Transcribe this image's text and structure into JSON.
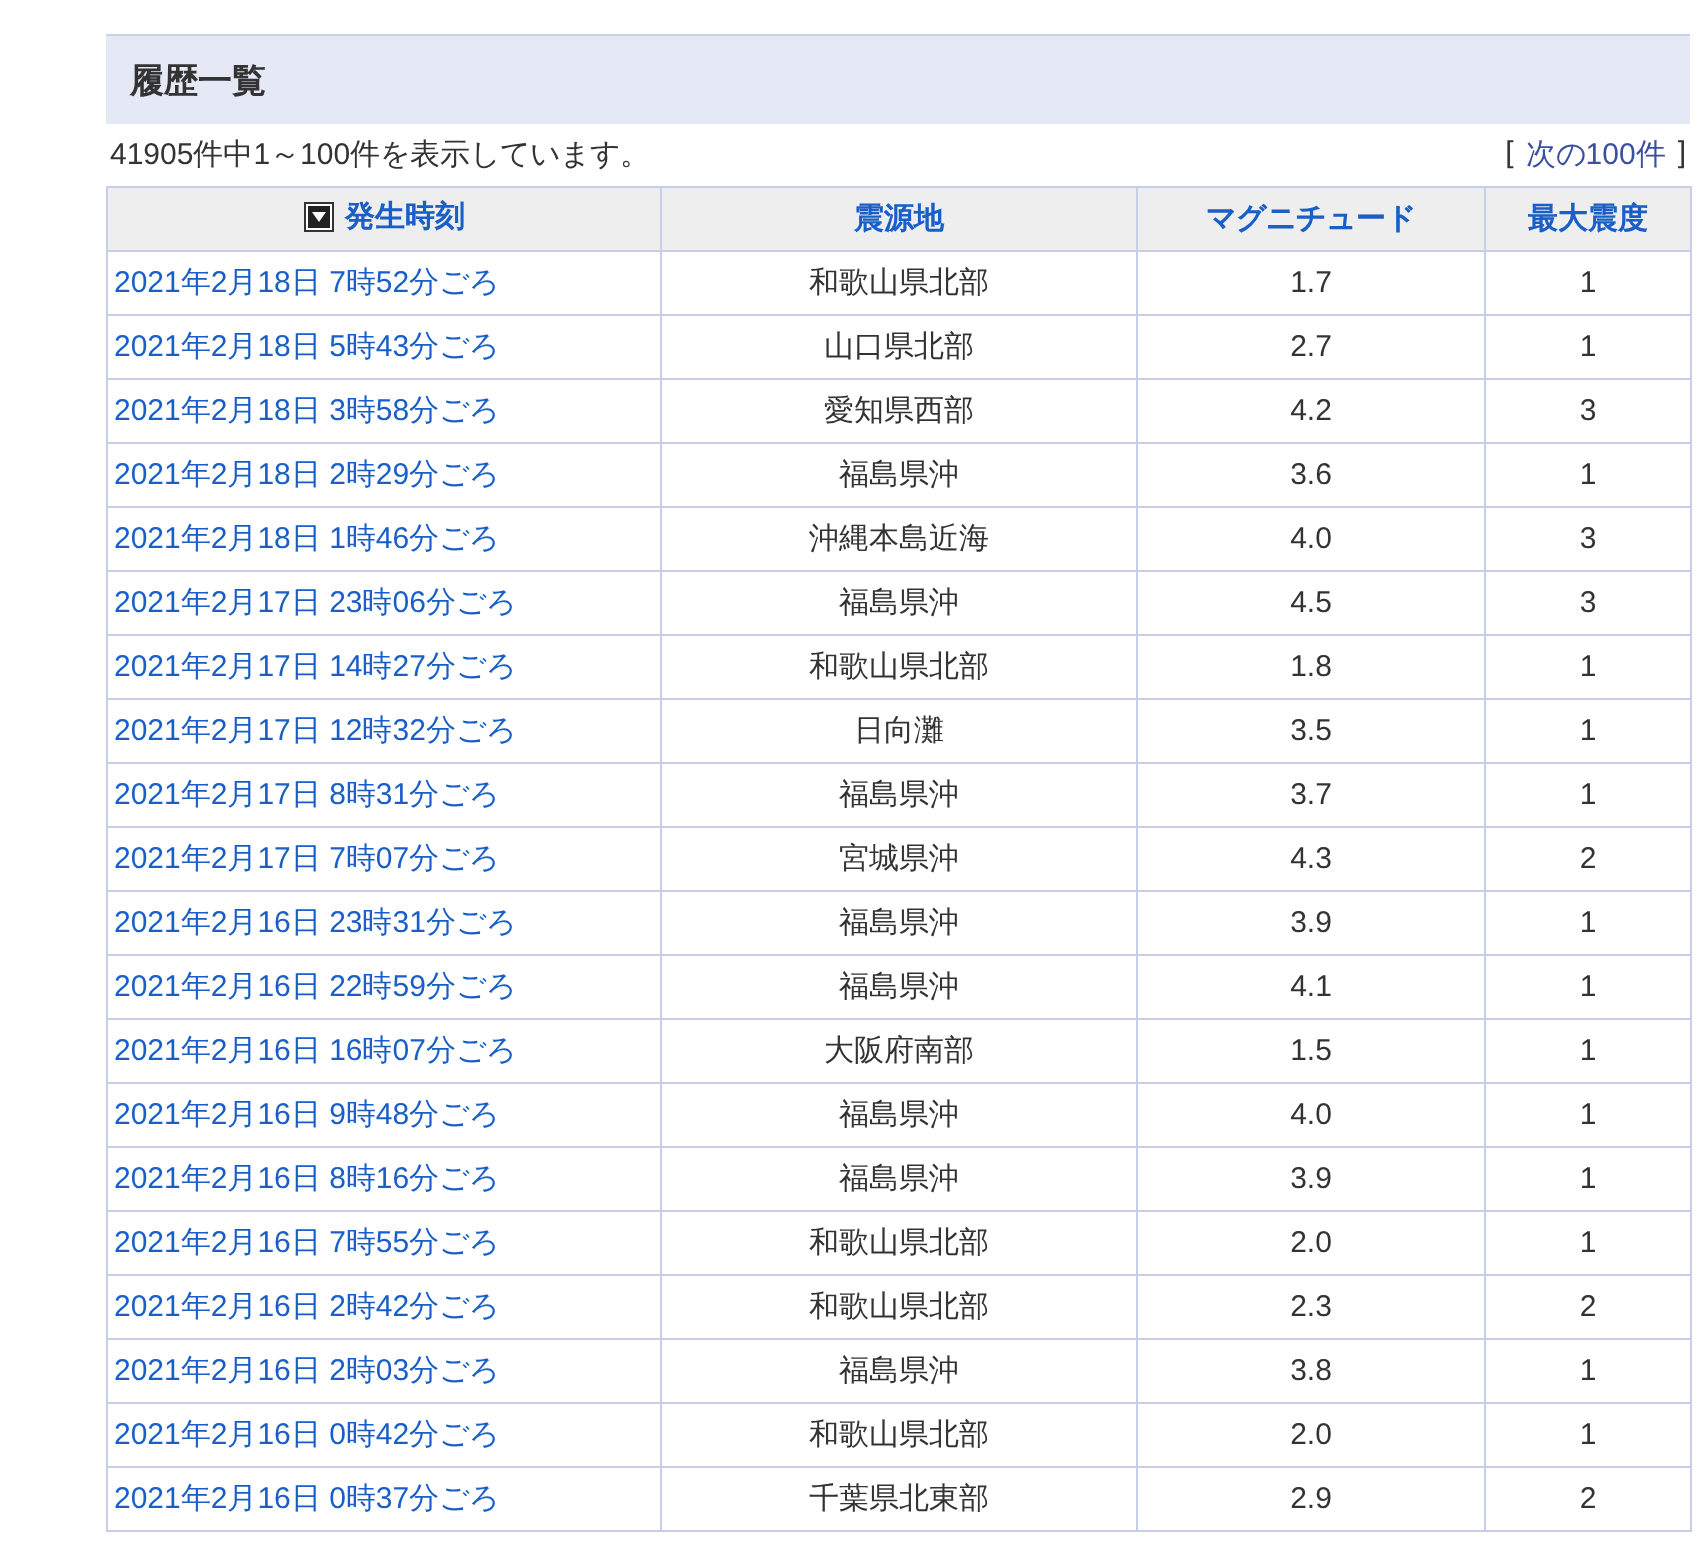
{
  "section": {
    "title": "履歴一覧"
  },
  "summary": "41905件中1～100件を表示しています。",
  "next_link": {
    "open": "[",
    "label": "次の100件",
    "close": "]"
  },
  "table": {
    "columns": [
      {
        "label": "発生時刻",
        "sorted": true
      },
      {
        "label": "震源地",
        "sorted": false
      },
      {
        "label": "マグニチュード",
        "sorted": false
      },
      {
        "label": "最大震度",
        "sorted": false
      }
    ],
    "rows": [
      [
        "2021年2月18日 7時52分ごろ",
        "和歌山県北部",
        "1.7",
        "1"
      ],
      [
        "2021年2月18日 5時43分ごろ",
        "山口県北部",
        "2.7",
        "1"
      ],
      [
        "2021年2月18日 3時58分ごろ",
        "愛知県西部",
        "4.2",
        "3"
      ],
      [
        "2021年2月18日 2時29分ごろ",
        "福島県沖",
        "3.6",
        "1"
      ],
      [
        "2021年2月18日 1時46分ごろ",
        "沖縄本島近海",
        "4.0",
        "3"
      ],
      [
        "2021年2月17日 23時06分ごろ",
        "福島県沖",
        "4.5",
        "3"
      ],
      [
        "2021年2月17日 14時27分ごろ",
        "和歌山県北部",
        "1.8",
        "1"
      ],
      [
        "2021年2月17日 12時32分ごろ",
        "日向灘",
        "3.5",
        "1"
      ],
      [
        "2021年2月17日 8時31分ごろ",
        "福島県沖",
        "3.7",
        "1"
      ],
      [
        "2021年2月17日 7時07分ごろ",
        "宮城県沖",
        "4.3",
        "2"
      ],
      [
        "2021年2月16日 23時31分ごろ",
        "福島県沖",
        "3.9",
        "1"
      ],
      [
        "2021年2月16日 22時59分ごろ",
        "福島県沖",
        "4.1",
        "1"
      ],
      [
        "2021年2月16日 16時07分ごろ",
        "大阪府南部",
        "1.5",
        "1"
      ],
      [
        "2021年2月16日 9時48分ごろ",
        "福島県沖",
        "4.0",
        "1"
      ],
      [
        "2021年2月16日 8時16分ごろ",
        "福島県沖",
        "3.9",
        "1"
      ],
      [
        "2021年2月16日 7時55分ごろ",
        "和歌山県北部",
        "2.0",
        "1"
      ],
      [
        "2021年2月16日 2時42分ごろ",
        "和歌山県北部",
        "2.3",
        "2"
      ],
      [
        "2021年2月16日 2時03分ごろ",
        "福島県沖",
        "3.8",
        "1"
      ],
      [
        "2021年2月16日 0時42分ごろ",
        "和歌山県北部",
        "2.0",
        "1"
      ],
      [
        "2021年2月16日 0時37分ごろ",
        "千葉県北東部",
        "2.9",
        "2"
      ]
    ]
  }
}
